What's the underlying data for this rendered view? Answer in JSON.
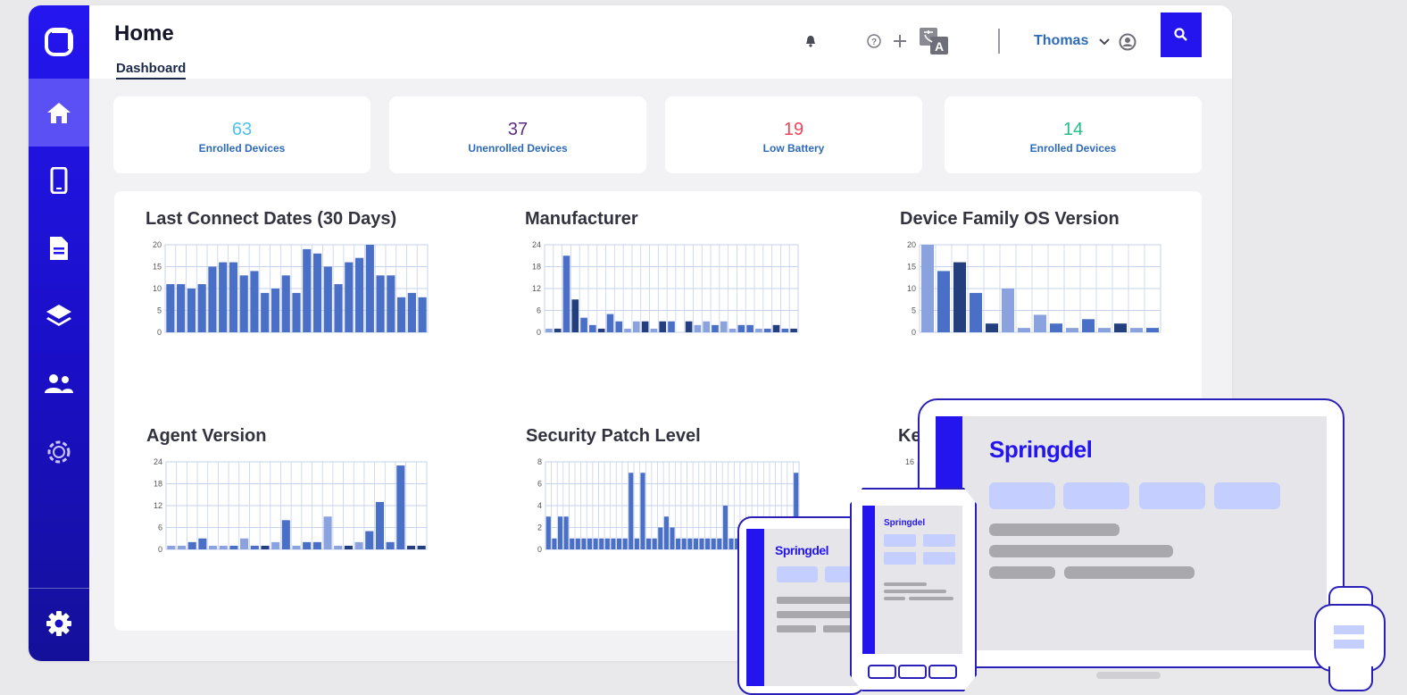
{
  "header": {
    "title": "Home",
    "tab": "Dashboard",
    "user": "Thomas"
  },
  "sidebar": {
    "items": [
      {
        "icon": "home-icon",
        "active": true
      },
      {
        "icon": "mobile-device-icon",
        "active": false
      },
      {
        "icon": "document-icon",
        "active": false
      },
      {
        "icon": "layers-icon",
        "active": false
      },
      {
        "icon": "users-icon",
        "active": false
      },
      {
        "icon": "api-gear-icon",
        "active": false
      }
    ],
    "footer_icon": "settings-icon"
  },
  "stats": [
    {
      "value": "63",
      "label": "Enrolled Devices",
      "color": "#4cc3f0"
    },
    {
      "value": "37",
      "label": "Unenrolled Devices",
      "color": "#5b2d86"
    },
    {
      "value": "19",
      "label": "Low Battery",
      "color": "#f0445a"
    },
    {
      "value": "14",
      "label": "Enrolled Devices",
      "color": "#1fbf86"
    }
  ],
  "colors": {
    "primary": "#2415ee",
    "bar": "#4a6fc7",
    "bar_dark": "#233f7d",
    "bar_light": "#8aa3df",
    "grid": "#c7d2ef"
  },
  "charts": [
    {
      "title": "Last Connect Dates (30 Days)"
    },
    {
      "title": "Manufacturer"
    },
    {
      "title": "Device Family OS Version"
    },
    {
      "title": "Agent Version"
    },
    {
      "title": "Security Patch Level"
    },
    {
      "title": "Ke"
    }
  ],
  "chart_data": [
    {
      "type": "bar",
      "title": "Last Connect Dates (30 Days)",
      "ylim": [
        0,
        20
      ],
      "yticks": [
        "0",
        "5",
        "10",
        "15",
        "20"
      ],
      "values": [
        11,
        11,
        10,
        11,
        15,
        16,
        16,
        13,
        14,
        9,
        10,
        13,
        9,
        19,
        18,
        15,
        11,
        16,
        17,
        20,
        13,
        13,
        8,
        9,
        8
      ],
      "shades": []
    },
    {
      "type": "bar",
      "title": "Manufacturer",
      "ylim": [
        0,
        24
      ],
      "yticks": [
        "0",
        "6",
        "12",
        "18",
        "24"
      ],
      "values": [
        1,
        1,
        21,
        9,
        4,
        2,
        1,
        5,
        3,
        1,
        3,
        3,
        1,
        3,
        3,
        0,
        3,
        2,
        3,
        2,
        3,
        1,
        2,
        2,
        1,
        1,
        2,
        1,
        1
      ],
      "shades": [
        "l",
        "d",
        "m",
        "d",
        "m",
        "m",
        "d",
        "m",
        "m",
        "l",
        "l",
        "d",
        "l",
        "d",
        "m",
        "l",
        "d",
        "l",
        "l",
        "m",
        "l",
        "l",
        "m",
        "m",
        "l",
        "m",
        "d",
        "m",
        "d"
      ]
    },
    {
      "type": "bar",
      "title": "Device Family OS Version",
      "ylim": [
        0,
        20
      ],
      "yticks": [
        "0",
        "5",
        "10",
        "15",
        "20"
      ],
      "values": [
        20,
        14,
        16,
        9,
        2,
        10,
        1,
        4,
        2,
        1,
        3,
        1,
        2,
        1,
        1
      ],
      "shades": [
        "l",
        "m",
        "d",
        "m",
        "d",
        "l",
        "l",
        "l",
        "m",
        "l",
        "m",
        "l",
        "d",
        "l",
        "m"
      ]
    },
    {
      "type": "bar",
      "title": "Agent Version",
      "ylim": [
        0,
        24
      ],
      "yticks": [
        "0",
        "6",
        "12",
        "18",
        "24"
      ],
      "values": [
        1,
        1,
        2,
        3,
        1,
        1,
        1,
        3,
        1,
        1,
        2,
        8,
        1,
        2,
        2,
        9,
        1,
        1,
        2,
        5,
        13,
        2,
        23,
        1,
        1
      ],
      "shades": [
        "l",
        "l",
        "m",
        "m",
        "l",
        "l",
        "m",
        "l",
        "m",
        "d",
        "l",
        "m",
        "l",
        "m",
        "m",
        "l",
        "l",
        "d",
        "l",
        "m",
        "m",
        "m",
        "m",
        "d",
        "d"
      ]
    },
    {
      "type": "bar",
      "title": "Security Patch Level",
      "ylim": [
        0,
        8
      ],
      "yticks": [
        "0",
        "2",
        "4",
        "6",
        "8"
      ],
      "values": [
        3,
        1,
        3,
        3,
        1,
        1,
        1,
        1,
        1,
        1,
        1,
        1,
        1,
        1,
        7,
        1,
        7,
        1,
        1,
        2,
        3,
        2,
        1,
        1,
        1,
        1,
        1,
        1,
        1,
        1,
        4,
        1,
        1,
        1,
        1,
        1,
        1,
        1,
        1,
        1,
        1,
        1,
        7
      ],
      "shades": []
    },
    {
      "type": "bar",
      "title": "Ke",
      "ylim": [
        0,
        16
      ],
      "yticks": [
        "16"
      ],
      "values": [],
      "shades": []
    }
  ],
  "devices": {
    "brand_large": "Springdel",
    "brand_small": "Springdel",
    "brand_phone": "Springdel"
  }
}
